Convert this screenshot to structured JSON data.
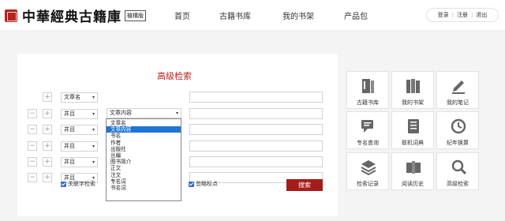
{
  "header": {
    "logo_text": "中華經典古籍庫",
    "logo_edition": "機構版",
    "nav": [
      "首页",
      "古籍书库",
      "我的书架",
      "产品包"
    ],
    "user_links": [
      "登录",
      "注册",
      "退出"
    ],
    "separator": "|"
  },
  "search": {
    "title": "高级检索",
    "first_field": "文章名",
    "rows": [
      {
        "logic": "并且",
        "field": "文章内容"
      },
      {
        "logic": "并且",
        "field": ""
      },
      {
        "logic": "并且",
        "field": ""
      },
      {
        "logic": "并且",
        "field": ""
      },
      {
        "logic": "并且",
        "field": ""
      }
    ],
    "dropdown_options": [
      "文章名",
      "文章内容",
      "书名",
      "作者",
      "出版社",
      "丛编",
      "图书简介",
      "正文",
      "注文",
      "专名词",
      "书名词"
    ],
    "dropdown_selected": "文章内容",
    "checkboxes": [
      "关联字检索",
      "忽略标点"
    ],
    "submit_label": "搜索",
    "plus": "+",
    "minus": "−",
    "caret": "▾"
  },
  "tiles": [
    {
      "label": "古籍书库",
      "icon": "bookshelf-icon"
    },
    {
      "label": "我的书架",
      "icon": "books-icon"
    },
    {
      "label": "我的笔记",
      "icon": "pen-note-icon"
    },
    {
      "label": "专名查询",
      "icon": "chat-search-icon"
    },
    {
      "label": "联机词典",
      "icon": "dictionary-icon"
    },
    {
      "label": "纪年换算",
      "icon": "history-clock-icon"
    },
    {
      "label": "检索记录",
      "icon": "layers-icon"
    },
    {
      "label": "阅读历史",
      "icon": "open-book-icon"
    },
    {
      "label": "高级检索",
      "icon": "magnifier-icon"
    }
  ],
  "colors": {
    "brand_red": "#b3231f",
    "button_red": "#a51d1b",
    "selected_blue": "#1e75d6",
    "icon_gray": "#666666"
  }
}
